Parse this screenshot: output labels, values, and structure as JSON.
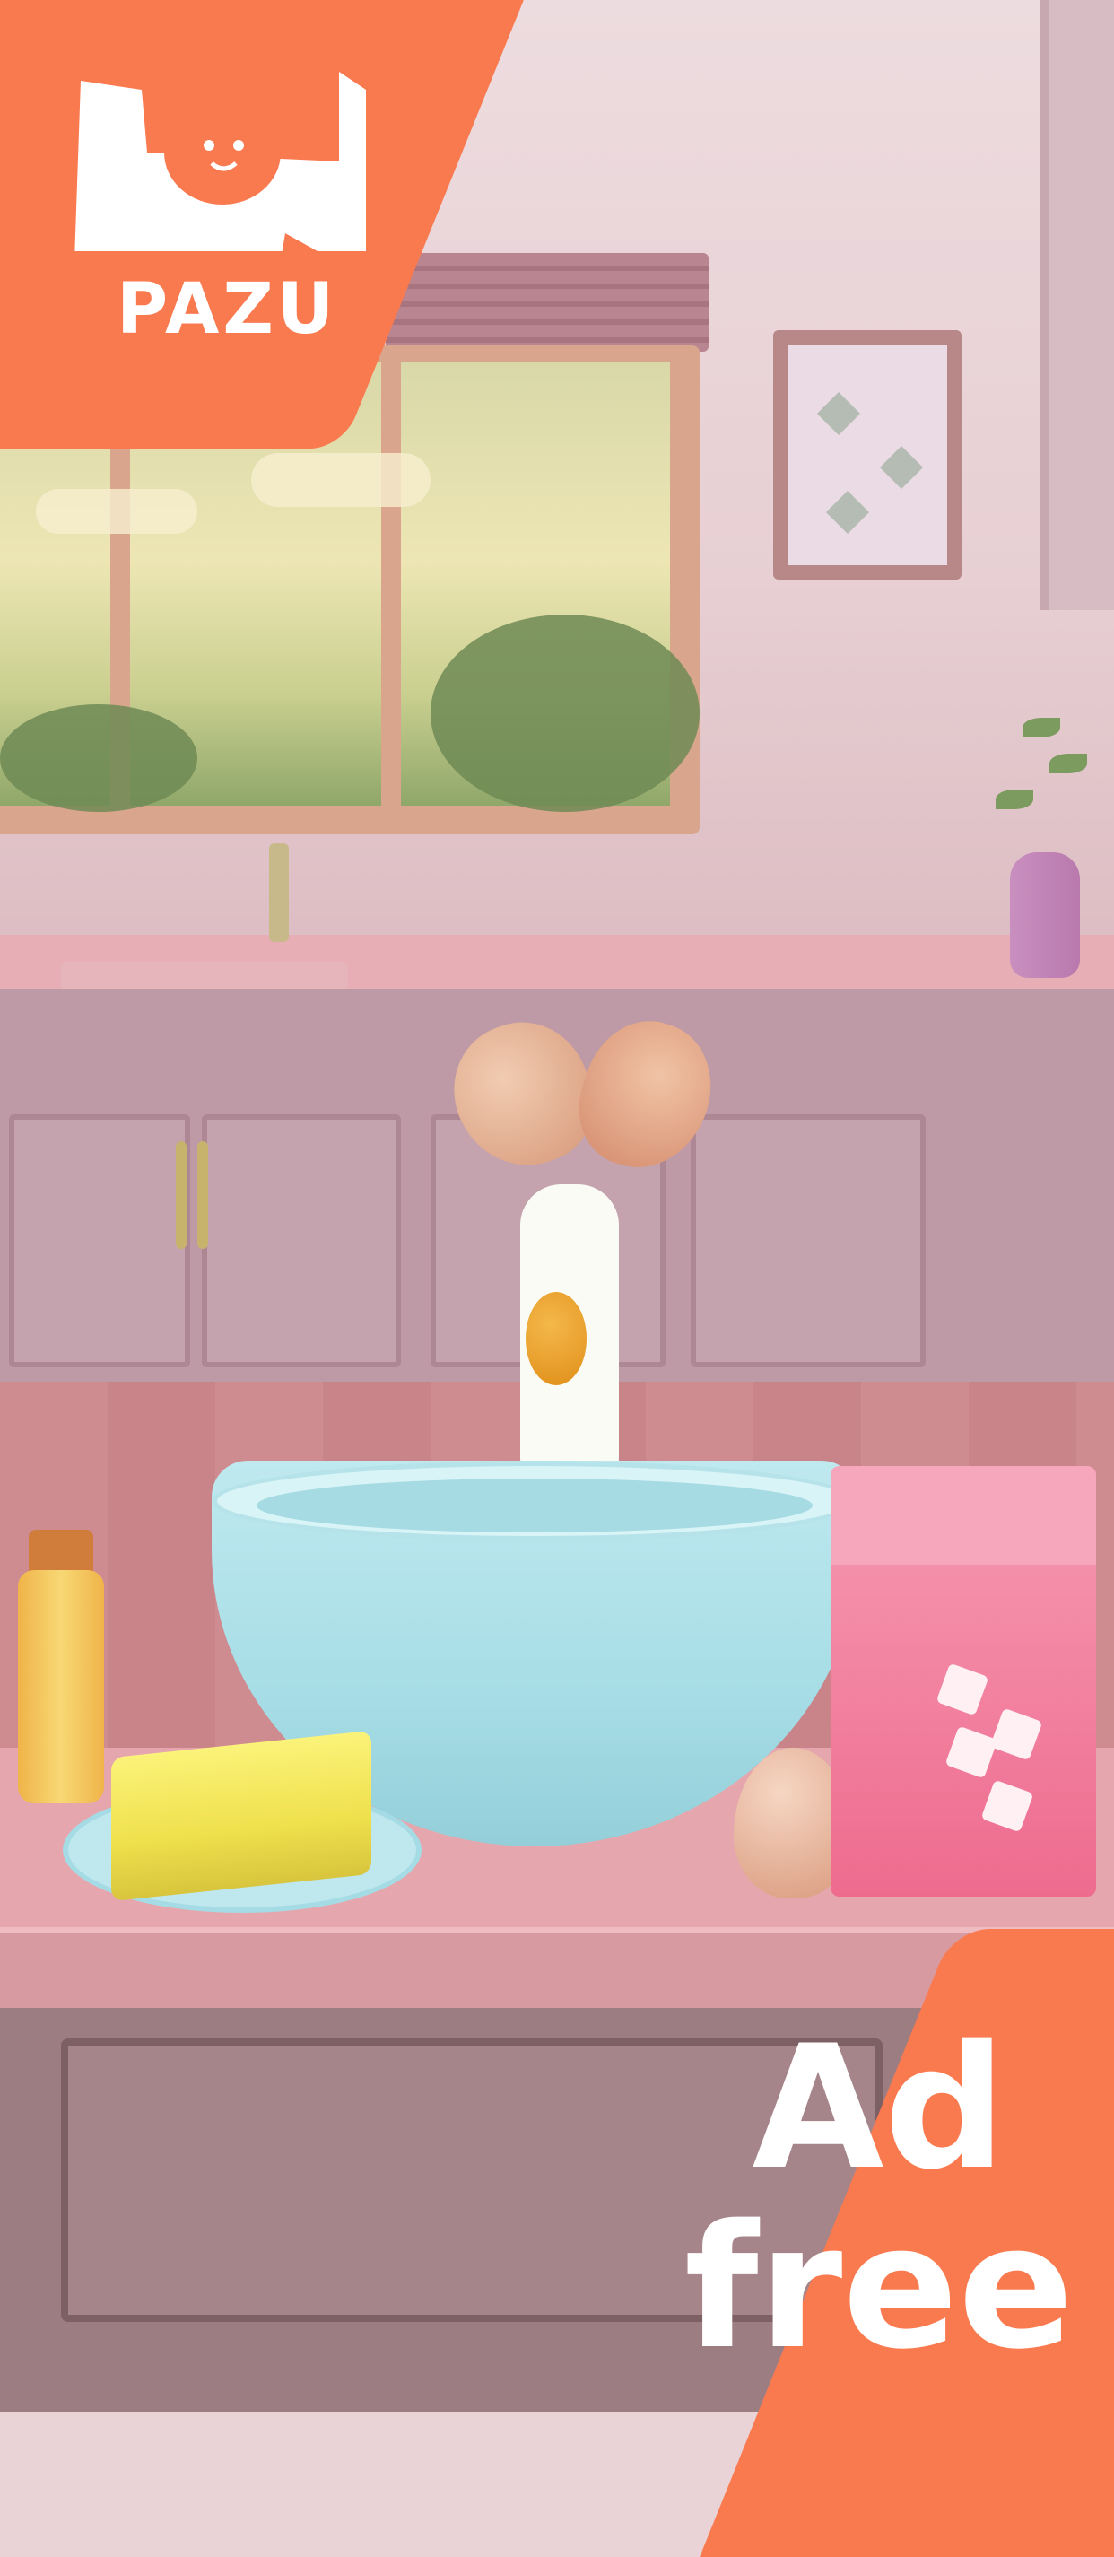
{
  "brand": {
    "name": "PAZU",
    "logo_icon": "pazu-elephant-logo",
    "accent_color": "#fa7a50"
  },
  "promo": {
    "line1": "Ad",
    "line2": "free"
  },
  "scene": {
    "items": [
      "egg-shell-icon",
      "cracked-egg-icon",
      "mixing-bowl-icon",
      "vanilla-bottle-icon",
      "butter-icon",
      "egg-icon",
      "sugar-box-icon"
    ]
  }
}
